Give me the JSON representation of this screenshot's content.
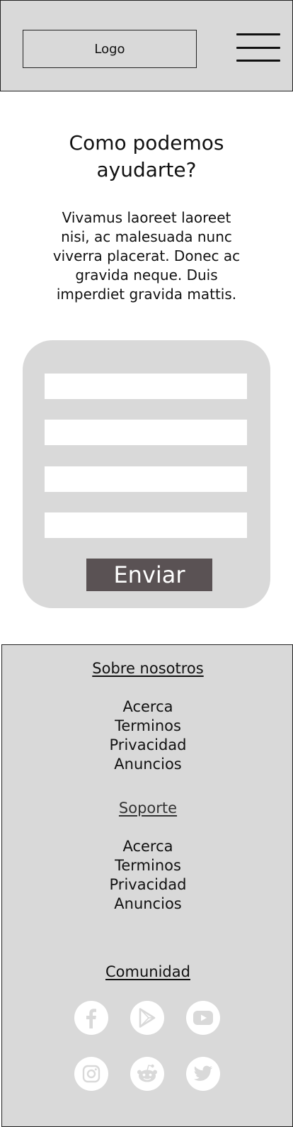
{
  "header": {
    "logo_label": "Logo",
    "menu_icon": "hamburger-menu-icon"
  },
  "hero": {
    "title": "Como podemos ayudarte?",
    "body": "Vivamus laoreet laoreet nisi, ac malesuada nunc viverra placerat. Donec ac gravida neque. Duis imperdiet gravida mattis."
  },
  "form": {
    "fields": [
      {
        "value": "",
        "placeholder": ""
      },
      {
        "value": "",
        "placeholder": ""
      },
      {
        "value": "",
        "placeholder": ""
      },
      {
        "value": "",
        "placeholder": ""
      }
    ],
    "submit_label": "Enviar",
    "colors": {
      "card": "#d9d9d9",
      "field": "#ffffff",
      "button": "#5a5254",
      "button_text": "#ffffff"
    }
  },
  "footer": {
    "sections": [
      {
        "heading": "Sobre nosotros",
        "links": [
          "Acerca",
          "Terminos",
          "Privacidad",
          "Anuncios"
        ]
      },
      {
        "heading": "Soporte",
        "links": [
          "Acerca",
          "Terminos",
          "Privacidad",
          "Anuncios"
        ]
      }
    ],
    "community": {
      "heading": "Comunidad",
      "icons": [
        "facebook-icon",
        "google-play-icon",
        "youtube-icon",
        "instagram-icon",
        "reddit-icon",
        "twitter-icon"
      ]
    },
    "colors": {
      "background": "#d9d9d9",
      "icon_circle": "#ffffff",
      "icon_glyph": "#d9d9d9"
    }
  }
}
